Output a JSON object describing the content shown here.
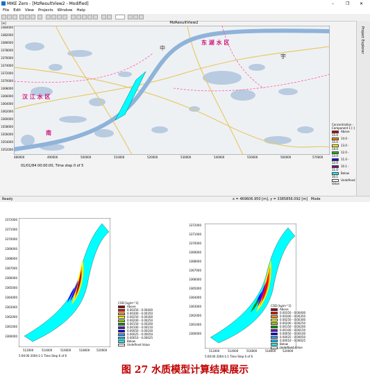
{
  "window": {
    "title": "MIKE Zero - [MzResultView2 - Modified]",
    "controls": [
      "–",
      "❐",
      "✕"
    ],
    "menu": [
      "File",
      "Edit",
      "View",
      "Projects",
      "Window",
      "Help"
    ],
    "view_title": "MzResultView2",
    "axis_unit_y": "[m]",
    "axis_unit_x": "[m]",
    "right_panel_label": "Project Explorer",
    "status_left": "Ready",
    "status_coords": "x = 469606.950 [m], y = 3385856.092 [m]",
    "status_mode": "Mode",
    "time_step": "01/01/84 00:00:00, Time step 0 of 5"
  },
  "map": {
    "yticks": [
      "3384000",
      "3382000",
      "3380000",
      "3378000",
      "3376000",
      "3374000",
      "3372000",
      "3370000",
      "3368000",
      "3366000",
      "3364000",
      "3362000",
      "3360000",
      "3358000",
      "3356000",
      "3354000",
      "3352000",
      "3350000"
    ],
    "xticks": [
      "480000",
      "490000",
      "500000",
      "510000",
      "520000",
      "530000",
      "540000",
      "550000",
      "560000",
      "570000"
    ],
    "labels": [
      {
        "text": "东 湖 水 区",
        "color": "#d0107a"
      },
      {
        "text": "汉 江 水 区",
        "color": "#d0107a"
      },
      {
        "text": "中",
        "color": "#333333"
      },
      {
        "text": "南",
        "color": "#d0107a"
      },
      {
        "text": "宇",
        "color": "#333333"
      }
    ],
    "legend_title": "Concentration - Component 1 [-]",
    "legend": [
      {
        "label": "Above 15.0",
        "color": "#c00000"
      },
      {
        "label": "14.0 - 15.0",
        "color": "#ff7f00"
      },
      {
        "label": "13.0 - 14.0",
        "color": "#ffff00"
      },
      {
        "label": "12.0 - 13.0",
        "color": "#00c000"
      },
      {
        "label": "11.0 - 12.0",
        "color": "#0000ff"
      },
      {
        "label": "10.1 - 11.0",
        "color": "#800080"
      },
      {
        "label": "Below 10.1",
        "color": "#00ffff"
      },
      {
        "label": "Undefined Value",
        "color": "#ffffff"
      }
    ]
  },
  "plots": [
    {
      "yticks": [
        "3372000",
        "3371000",
        "3370000",
        "3369000",
        "3368000",
        "3367000",
        "3366000",
        "3365000",
        "3364000",
        "3363000",
        "3362000",
        "3361000",
        "3360000",
        "3359000"
      ],
      "xticks": [
        "512000",
        "514000",
        "516000",
        "518000",
        "520000"
      ],
      "time_label": "5:00:00 2004-1-1 Time Step 6 of 6",
      "legend_title": "COD [kg/m^3]",
      "legend": [
        {
          "label": "Above",
          "color": "#9c0000"
        },
        {
          "label": "0.00350 - 0.00400",
          "color": "#ff0000"
        },
        {
          "label": "0.00300 - 0.00350",
          "color": "#ff9900"
        },
        {
          "label": "0.00250 - 0.00300",
          "color": "#ffff00"
        },
        {
          "label": "0.00200 - 0.00250",
          "color": "#99cc00"
        },
        {
          "label": "0.00150 - 0.00200",
          "color": "#009900"
        },
        {
          "label": "0.00100 - 0.00150",
          "color": "#6600cc"
        },
        {
          "label": "0.00050 - 0.00100",
          "color": "#0000ff"
        },
        {
          "label": "0.00025 - 0.00050",
          "color": "#3399ff"
        },
        {
          "label": "0.00010 - 0.00025",
          "color": "#00ccff"
        },
        {
          "label": "Below",
          "color": "#00ffff"
        },
        {
          "label": "Undefined Value",
          "color": "#ffffff"
        }
      ]
    },
    {
      "yticks": [
        "3372000",
        "3371000",
        "3370000",
        "3369000",
        "3368000",
        "3367000",
        "3366000",
        "3365000",
        "3364000",
        "3363000",
        "3362000",
        "3361000",
        "3360000",
        "3359000"
      ],
      "xticks": [
        "512000",
        "514000",
        "516000",
        "518000",
        "520000"
      ],
      "time_label": "5:00:00 2004-1-1 Time Step 6 of 6",
      "legend_title": "COD [kg/m^3]",
      "legend": [
        {
          "label": "Above",
          "color": "#9c0000"
        },
        {
          "label": "0.00350 - 0.00400",
          "color": "#ff0000"
        },
        {
          "label": "0.00300 - 0.00350",
          "color": "#ff9900"
        },
        {
          "label": "0.00250 - 0.00300",
          "color": "#ffff00"
        },
        {
          "label": "0.00200 - 0.00250",
          "color": "#99cc00"
        },
        {
          "label": "0.00150 - 0.00200",
          "color": "#009900"
        },
        {
          "label": "0.00100 - 0.00150",
          "color": "#6600cc"
        },
        {
          "label": "0.00050 - 0.00100",
          "color": "#0000ff"
        },
        {
          "label": "0.00025 - 0.00050",
          "color": "#3399ff"
        },
        {
          "label": "0.00010 - 0.00025",
          "color": "#00ccff"
        },
        {
          "label": "Below",
          "color": "#00ffff"
        },
        {
          "label": "Undefined Value",
          "color": "#ffffff"
        }
      ]
    }
  ],
  "caption": "图 27   水质模型计算结果展示"
}
